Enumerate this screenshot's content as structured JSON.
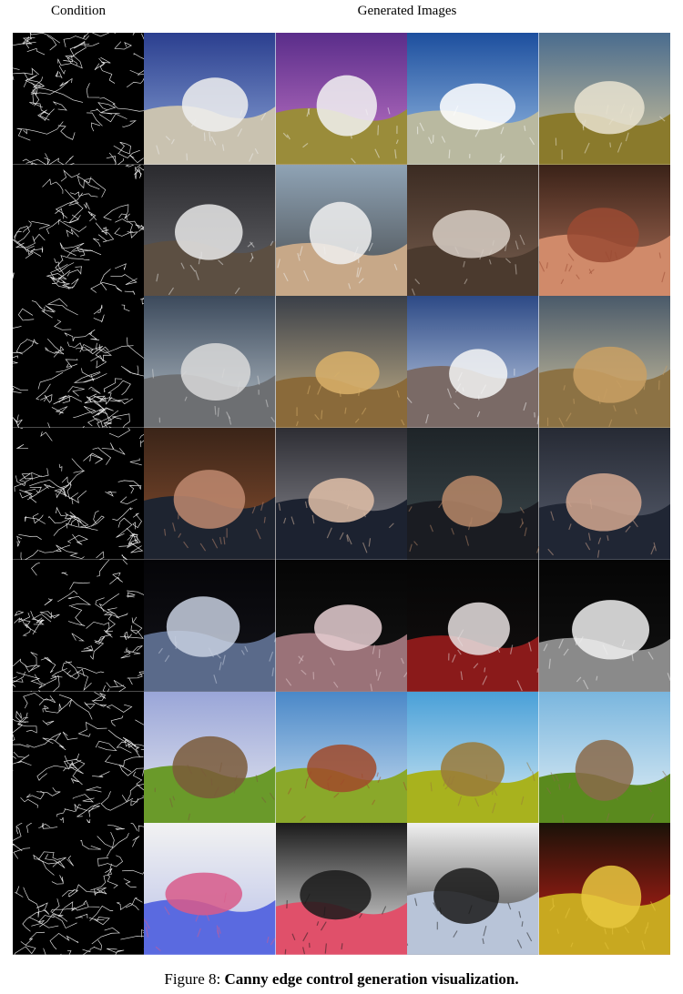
{
  "header": {
    "condition_label": "Condition",
    "generated_label": "Generated Images"
  },
  "caption": {
    "prefix": "Figure 8:",
    "text": "Canny edge control generation visualization."
  },
  "rows": [
    {
      "subject": "mountain-path",
      "images": [
        {
          "kind": "edge"
        },
        {
          "kind": "gen",
          "sky": [
            "#2b3f8f",
            "#8da6d8"
          ],
          "land": "#c9c2b0",
          "accent": "#eeeeee"
        },
        {
          "kind": "gen",
          "sky": [
            "#5a2d8a",
            "#c478c8"
          ],
          "land": "#9a8c3a",
          "accent": "#f2f2f2"
        },
        {
          "kind": "gen",
          "sky": [
            "#1d4f9e",
            "#9cc0e6"
          ],
          "land": "#b9b9a0",
          "accent": "#ffffff"
        },
        {
          "kind": "gen",
          "sky": [
            "#4a6c8e",
            "#d5c69a"
          ],
          "land": "#8a7a2c",
          "accent": "#e9e3d0"
        }
      ]
    },
    {
      "subject": "running-horse",
      "images": [
        {
          "kind": "edge"
        },
        {
          "kind": "gen",
          "sky": [
            "#2a2a2e",
            "#6a6a6e"
          ],
          "land": "#5c4f42",
          "accent": "#e8e8e8"
        },
        {
          "kind": "gen",
          "sky": [
            "#8fa3b5",
            "#45484a"
          ],
          "land": "#c7a888",
          "accent": "#f0f0f0"
        },
        {
          "kind": "gen",
          "sky": [
            "#3b2b22",
            "#7a6050"
          ],
          "land": "#4b3a2e",
          "accent": "#d8cfc6"
        },
        {
          "kind": "gen",
          "sky": [
            "#3a2218",
            "#b0725a"
          ],
          "land": "#d08a6a",
          "accent": "#9a4a32"
        }
      ]
    },
    {
      "subject": "shipwreck",
      "images": [
        {
          "kind": "edge"
        },
        {
          "kind": "gen",
          "sky": [
            "#3c4a5c",
            "#b6c0c8"
          ],
          "land": "#6d6f72",
          "accent": "#d9d9d9"
        },
        {
          "kind": "gen",
          "sky": [
            "#3a3f48",
            "#c8b48a"
          ],
          "land": "#8a6a3a",
          "accent": "#d9b06a"
        },
        {
          "kind": "gen",
          "sky": [
            "#2d4a86",
            "#c9d6ea"
          ],
          "land": "#7a6a66",
          "accent": "#f4f4f4"
        },
        {
          "kind": "gen",
          "sky": [
            "#4a5a6a",
            "#d6c8a2"
          ],
          "land": "#8c7244",
          "accent": "#c9a064"
        }
      ]
    },
    {
      "subject": "man-in-suit",
      "images": [
        {
          "kind": "edge"
        },
        {
          "kind": "gen",
          "sky": [
            "#3a2418",
            "#8a5030"
          ],
          "land": "#1e2430",
          "accent": "#c08a70"
        },
        {
          "kind": "gen",
          "sky": [
            "#2e2e34",
            "#8e8e96"
          ],
          "land": "#1c2230",
          "accent": "#e0c0a8"
        },
        {
          "kind": "gen",
          "sky": [
            "#1e2428",
            "#3e4a4e"
          ],
          "land": "#1a1c22",
          "accent": "#b88868"
        },
        {
          "kind": "gen",
          "sky": [
            "#262a34",
            "#5a6070"
          ],
          "land": "#202634",
          "accent": "#d4a890"
        }
      ]
    },
    {
      "subject": "vintage-car",
      "images": [
        {
          "kind": "edge"
        },
        {
          "kind": "gen",
          "sky": [
            "#050508",
            "#14141a"
          ],
          "land": "#5a6a8a",
          "accent": "#c8d0e0"
        },
        {
          "kind": "gen",
          "sky": [
            "#050505",
            "#141414"
          ],
          "land": "#9a7278",
          "accent": "#e6cfd2"
        },
        {
          "kind": "gen",
          "sky": [
            "#050505",
            "#141010"
          ],
          "land": "#8a1a1a",
          "accent": "#e8e0e0"
        },
        {
          "kind": "gen",
          "sky": [
            "#050505",
            "#121212"
          ],
          "land": "#8a8a8a",
          "accent": "#f0f0f0"
        }
      ]
    },
    {
      "subject": "cottage",
      "images": [
        {
          "kind": "edge"
        },
        {
          "kind": "gen",
          "sky": [
            "#9aa6d8",
            "#e6e8f0"
          ],
          "land": "#6a9a2a",
          "accent": "#7a5a3a"
        },
        {
          "kind": "gen",
          "sky": [
            "#4a88c8",
            "#cfe2f2"
          ],
          "land": "#8aa82a",
          "accent": "#a04a2a"
        },
        {
          "kind": "gen",
          "sky": [
            "#4aa0d8",
            "#d8ecf4"
          ],
          "land": "#a8b21e",
          "accent": "#9a7a3a"
        },
        {
          "kind": "gen",
          "sky": [
            "#7ab6de",
            "#e4f0f6"
          ],
          "land": "#5a8a1e",
          "accent": "#8a6a4a"
        }
      ]
    },
    {
      "subject": "comic-man",
      "images": [
        {
          "kind": "edge"
        },
        {
          "kind": "gen",
          "sky": [
            "#f2f2f2",
            "#b8c0e8"
          ],
          "land": "#5a6ae0",
          "accent": "#d85a8a"
        },
        {
          "kind": "gen",
          "sky": [
            "#1a1a1a",
            "#f0f0f0"
          ],
          "land": "#e0506a",
          "accent": "#1a1a1a"
        },
        {
          "kind": "gen",
          "sky": [
            "#f0f0f0",
            "#2a2a2a"
          ],
          "land": "#b8c4d8",
          "accent": "#1a1a1a"
        },
        {
          "kind": "gen",
          "sky": [
            "#1a1208",
            "#d02018"
          ],
          "land": "#c8a820",
          "accent": "#e8c840"
        }
      ]
    }
  ]
}
